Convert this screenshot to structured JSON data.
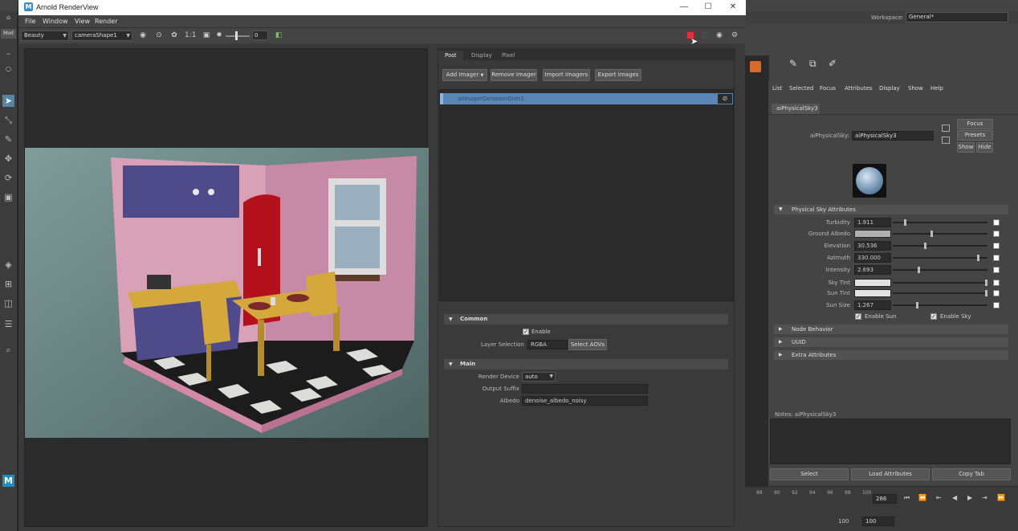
{
  "maya": {
    "workspace_label": "Workspace:",
    "workspace_value": "General*",
    "left_tool_label": "Mod",
    "ae_menu": [
      "List",
      "Selected",
      "Focus",
      "Attributes",
      "Display",
      "Show",
      "Help"
    ],
    "node_tab": "aiPhysicalSky3",
    "node_type_label": "aiPhysicalSky:",
    "node_name": "aiPhysicalSky3",
    "focus_button": "Focus",
    "presets_button": "Presets",
    "show_button": "Show",
    "hide_button": "Hide",
    "section_physical_sky": "Physical Sky Attributes",
    "attrs": [
      {
        "label": "Turbidity",
        "value": "1.911",
        "slider": 0.12
      },
      {
        "label": "Ground Albedo",
        "value": "",
        "slider": 0.41,
        "swatch": true
      },
      {
        "label": "Elevation",
        "value": "30.536",
        "slider": 0.34
      },
      {
        "label": "Azimuth",
        "value": "330.000",
        "slider": 0.91
      },
      {
        "label": "Intensity",
        "value": "2.693",
        "slider": 0.27
      },
      {
        "label": "Sky Tint",
        "value": "",
        "slider": 1.0,
        "swatch": true
      },
      {
        "label": "Sun Tint",
        "value": "",
        "slider": 1.0,
        "swatch": true
      },
      {
        "label": "Sun Size",
        "value": "1.267",
        "slider": 0.25
      }
    ],
    "enable_sun": "Enable Sun",
    "enable_sky": "Enable Sky",
    "section_node_behavior": "Node Behavior",
    "section_uuid": "UUID",
    "section_extra": "Extra Attributes",
    "notes_label": "Notes: aiPhysicalSky3",
    "bottom_buttons": [
      "Select",
      "Load Attributes",
      "Copy Tab"
    ],
    "timeline_ticks": [
      "88",
      "90",
      "92",
      "94",
      "96",
      "98",
      "100"
    ],
    "current_frame": "286",
    "range_start": "100",
    "range_end": "100"
  },
  "arnold": {
    "window_title": "Arnold RenderView",
    "menu": [
      "File",
      "Window",
      "View",
      "Render"
    ],
    "aov_combo": "Beauty",
    "camera_combo": "cameraShape1",
    "ratio_label": "1:1",
    "exposure_value": "0",
    "tabs": [
      "Post",
      "Display",
      "Pixel"
    ],
    "active_tab": "Post",
    "buttons": {
      "add_imager": "Add Imager",
      "remove_imager": "Remove Imager",
      "import_imagers": "Import Imagers",
      "export_imagers": "Export Images"
    },
    "imager_item": "aiImagerDenoiserOidn1",
    "common_section": "Common",
    "enable_label": "Enable",
    "layer_selection_label": "Layer Selection",
    "layer_selection_value": "RGBA",
    "select_aovs_button": "Select AOVs",
    "main_section": "Main",
    "render_device_label": "Render Device",
    "render_device_value": "auto",
    "output_suffix_label": "Output Suffix",
    "output_suffix_value": "",
    "albedo_label": "Albedo",
    "albedo_value": "denoise_albedo_noisy"
  },
  "colors": {
    "accent_blue": "#5a86b5",
    "stop_button": "#d9343a"
  }
}
